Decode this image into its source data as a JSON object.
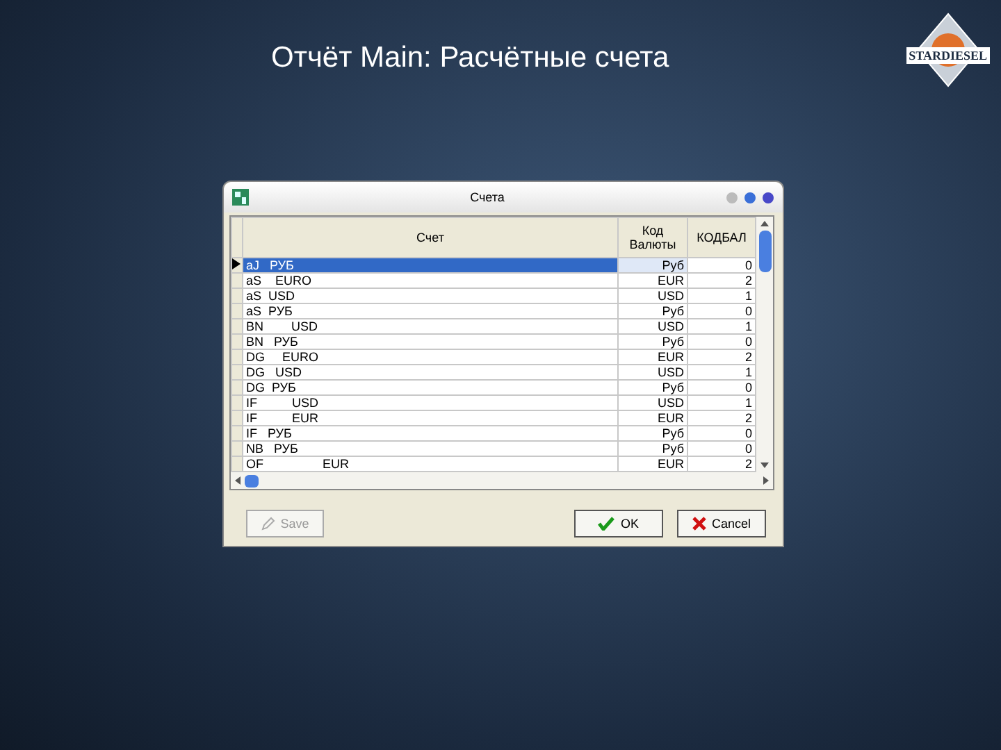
{
  "slide": {
    "title": "Отчёт Main: Расчётные счета",
    "logo": "STARDIESEL"
  },
  "dialog": {
    "title": "Счета",
    "table": {
      "columns": [
        "Счет",
        "Код Валюты",
        "КОДБАЛ"
      ],
      "rows": [
        {
          "cells": [
            "aJ   РУБ",
            "Руб",
            "0"
          ],
          "selected": true
        },
        {
          "cells": [
            "aS    EURO",
            "EUR",
            "2"
          ],
          "selected": false
        },
        {
          "cells": [
            "aS  USD",
            "USD",
            "1"
          ],
          "selected": false
        },
        {
          "cells": [
            "aS  РУБ",
            "Руб",
            "0"
          ],
          "selected": false
        },
        {
          "cells": [
            "BN        USD",
            "USD",
            "1"
          ],
          "selected": false
        },
        {
          "cells": [
            "BN   РУБ",
            "Руб",
            "0"
          ],
          "selected": false
        },
        {
          "cells": [
            "DG     EURO",
            "EUR",
            "2"
          ],
          "selected": false
        },
        {
          "cells": [
            "DG   USD",
            "USD",
            "1"
          ],
          "selected": false
        },
        {
          "cells": [
            "DG  РУБ",
            "Руб",
            "0"
          ],
          "selected": false
        },
        {
          "cells": [
            "IF          USD",
            "USD",
            "1"
          ],
          "selected": false
        },
        {
          "cells": [
            "IF          EUR",
            "EUR",
            "2"
          ],
          "selected": false
        },
        {
          "cells": [
            "IF   РУБ",
            "Руб",
            "0"
          ],
          "selected": false
        },
        {
          "cells": [
            "NB   РУБ",
            "Руб",
            "0"
          ],
          "selected": false
        },
        {
          "cells": [
            "OF                 EUR",
            "EUR",
            "2"
          ],
          "selected": false
        }
      ]
    },
    "buttons": [
      {
        "label": "Save",
        "kind": "save",
        "disabled": true
      },
      {
        "label": "OK",
        "kind": "ok",
        "disabled": false
      },
      {
        "label": "Cancel",
        "kind": "cancel",
        "disabled": false
      }
    ]
  }
}
